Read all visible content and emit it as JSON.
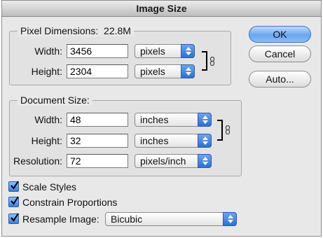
{
  "window": {
    "title": "Image Size"
  },
  "pixel_dimensions": {
    "legend": "Pixel Dimensions:",
    "total": "22.8M",
    "width": {
      "label": "Width:",
      "value": "3456",
      "unit": "pixels"
    },
    "height": {
      "label": "Height:",
      "value": "2304",
      "unit": "pixels"
    }
  },
  "document_size": {
    "legend": "Document Size:",
    "width": {
      "label": "Width:",
      "value": "48",
      "unit": "inches"
    },
    "height": {
      "label": "Height:",
      "value": "32",
      "unit": "inches"
    },
    "resolution": {
      "label": "Resolution:",
      "value": "72",
      "unit": "pixels/inch"
    }
  },
  "options": {
    "scale_styles": {
      "label": "Scale Styles",
      "checked": true
    },
    "constrain_proportions": {
      "label": "Constrain Proportions",
      "checked": true
    },
    "resample_image": {
      "label": "Resample Image:",
      "checked": true,
      "method": "Bicubic"
    }
  },
  "buttons": {
    "ok": "OK",
    "cancel": "Cancel",
    "auto": "Auto..."
  },
  "colors": {
    "accent": "#3b7ddd",
    "window_bg": "#e8e8e8"
  },
  "icons": {
    "link": "chain-link-icon",
    "checkbox": "checkmark-icon",
    "popup": "up-down-arrows-icon"
  }
}
